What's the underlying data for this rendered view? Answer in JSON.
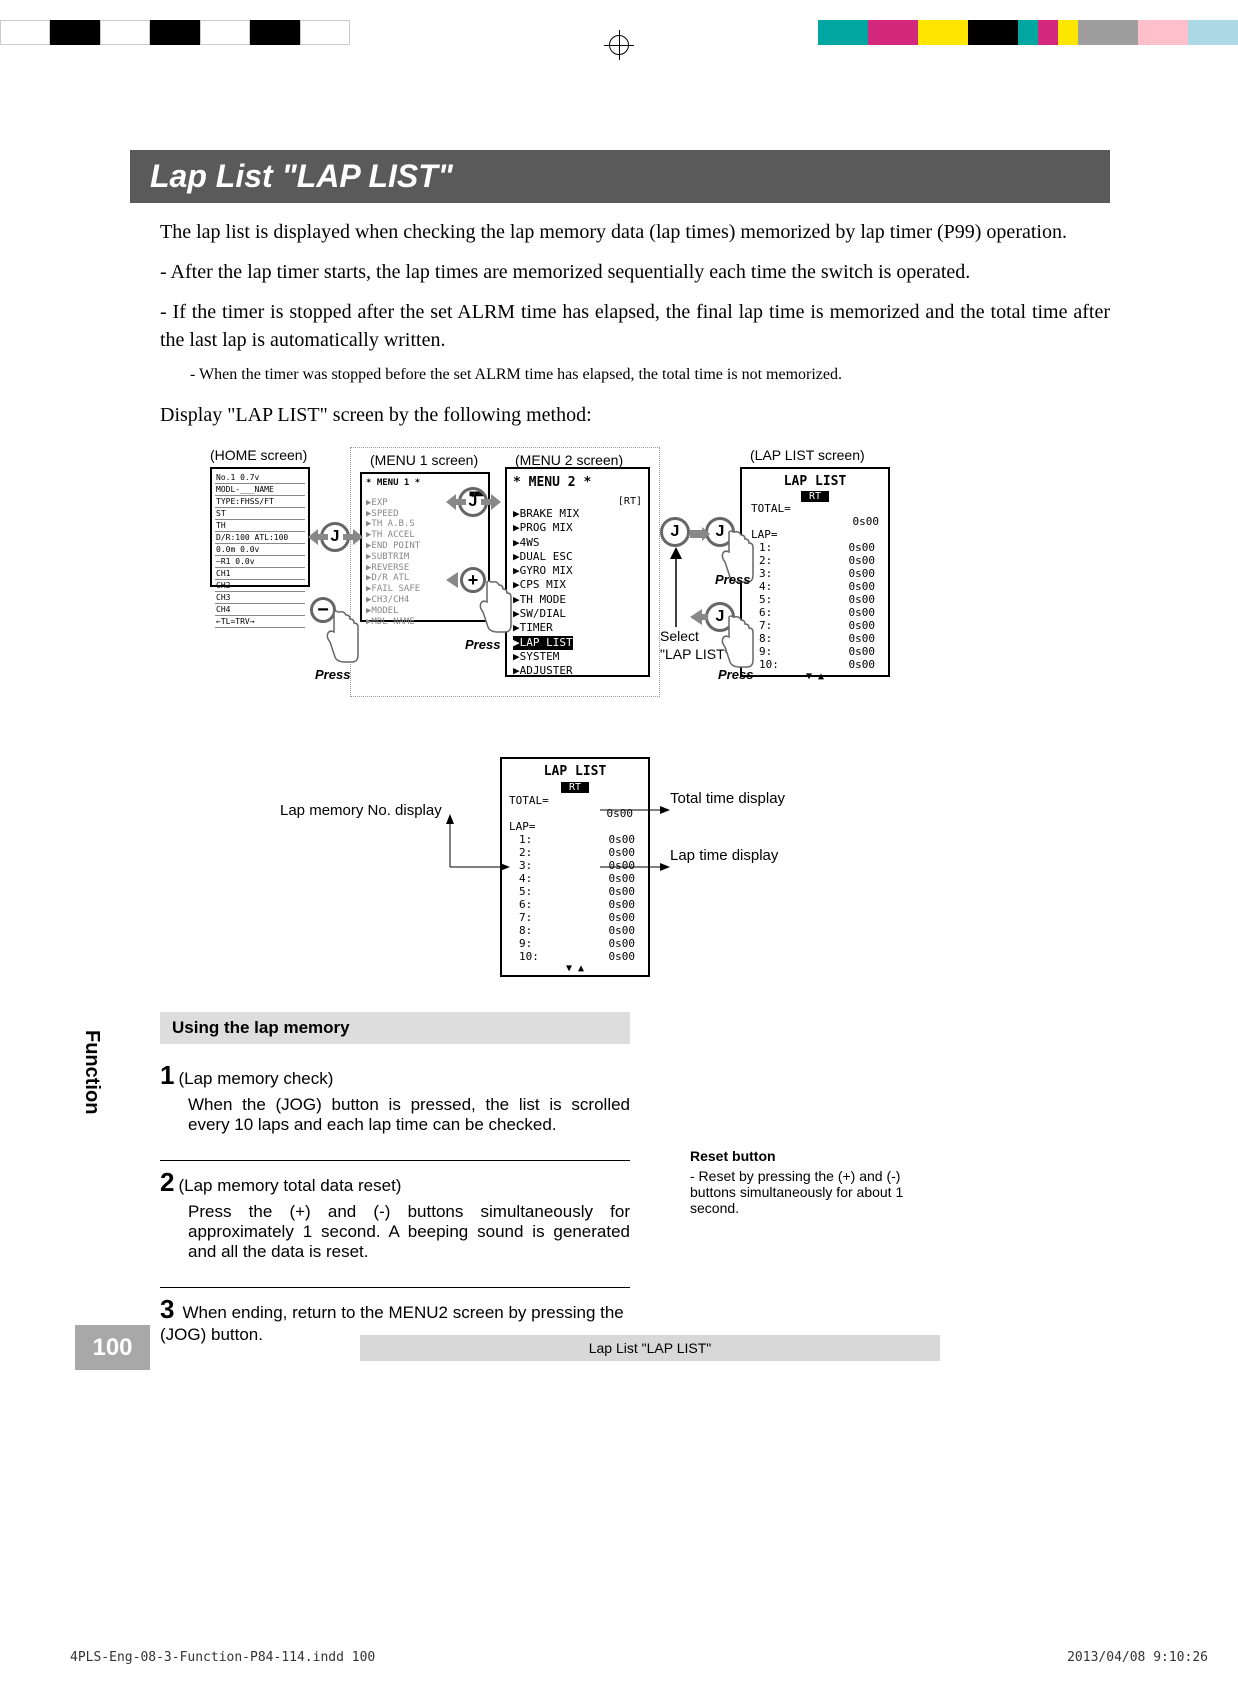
{
  "colorbars": {
    "left": [
      "#fff",
      "#000",
      "#fff",
      "#000",
      "#fff",
      "#000",
      "#fff"
    ],
    "right": [
      "#00a7a0",
      "#d4287d",
      "#ffe600",
      "#000",
      "#00a7a0",
      "#d4287d",
      "#ffe600",
      "#9e9e9e",
      "#9e9e9e",
      "#9e9e9e",
      "#ffc0cb",
      "#add8e6"
    ]
  },
  "title": "Lap List  \"LAP LIST\"",
  "intro1": "The lap list is displayed when checking the lap memory data (lap times) memorized by lap timer (P99) operation.",
  "intro2": "- After the lap timer starts, the lap times are memorized sequentially each time the switch is operated.",
  "intro3": "- If the timer is stopped after the set ALRM time has elapsed, the final lap time is memorized and the total time after the last lap is automatically written.",
  "intro_note": "- When the timer was stopped before the set ALRM time has elapsed, the total time is not memorized.",
  "subhead": "Display \"LAP LIST\" screen by the following method:",
  "screens": {
    "home": "(HOME screen)",
    "menu1": "(MENU 1 screen)",
    "menu2": "(MENU 2 screen)",
    "laplist": "(LAP LIST screen)"
  },
  "home_lines": [
    "No.1    0.7v",
    "MODL-___NAME",
    "TYPE:FHSS/FT",
    "ST",
    "TH",
    "D/R:100 ATL:100",
    "0.0m 0.0v",
    "—R1 0.0v",
    "CH1",
    "CH2",
    "CH3",
    "CH4",
    "←TL=TRV→"
  ],
  "menu1_hdr": "* MENU 1 *",
  "menu1_items": [
    "▶EXP",
    "▶SPEED",
    "▶TH A.B.S",
    "▶TH ACCEL",
    "▶END POINT",
    "▶SUBTRIM",
    "▶REVERSE",
    "▶D/R ATL",
    "▶FAIL SAFE",
    "▶CH3/CH4",
    "",
    "▶MODEL",
    "▶MDL NAME"
  ],
  "menu2_hdr": "* MENU 2 *",
  "menu2_rt": "[RT]",
  "menu2_items": [
    "▶BRAKE MIX",
    "▶PROG MIX",
    "▶4WS",
    "▶DUAL ESC",
    "▶GYRO MIX",
    "▶CPS MIX",
    "▶TH MODE",
    "",
    "▶SW/DIAL",
    "▶TIMER",
    "▶LAP LIST",
    "▶SYSTEM",
    "▶ADJUSTER"
  ],
  "menu2_selected_index": 10,
  "select_label": "Select\n\"LAP LIST\"",
  "press": "Press",
  "jog": "J",
  "plus": "+",
  "minus": "−",
  "laplist": {
    "header": "LAP LIST",
    "rt": "RT",
    "total_label": "TOTAL=",
    "total_value": "0s00",
    "lap_label": "LAP=",
    "laps": [
      {
        "n": "1:",
        "v": "0s00"
      },
      {
        "n": "2:",
        "v": "0s00"
      },
      {
        "n": "3:",
        "v": "0s00"
      },
      {
        "n": "4:",
        "v": "0s00"
      },
      {
        "n": "5:",
        "v": "0s00"
      },
      {
        "n": "6:",
        "v": "0s00"
      },
      {
        "n": "7:",
        "v": "0s00"
      },
      {
        "n": "8:",
        "v": "0s00"
      },
      {
        "n": "9:",
        "v": "0s00"
      },
      {
        "n": "10:",
        "v": "0s00"
      }
    ]
  },
  "callouts": {
    "total": "Total time display",
    "lap_no": "Lap memory No. display",
    "lap_time": "Lap time display"
  },
  "using_header": "Using the lap memory",
  "steps": [
    {
      "num": "1",
      "title": "(Lap memory check)",
      "body": "When the (JOG) button is pressed, the list is scrolled every 10 laps and each lap time can be checked."
    },
    {
      "num": "2",
      "title": "(Lap memory total data reset)",
      "body": "Press the (+) and (-) buttons simultaneously for approximately 1 second. A beeping sound is generated and all the data is reset."
    },
    {
      "num": "3",
      "title": "",
      "body": "When ending, return to the MENU2 screen by pressing the (JOG) button."
    }
  ],
  "reset": {
    "header": "Reset button",
    "body": "- Reset by pressing the (+) and (-) buttons simultaneously for about 1 second."
  },
  "function_tab": "Function",
  "page_number": "100",
  "footer_title": "Lap List  \"LAP LIST\"",
  "indd": "4PLS-Eng-08-3-Function-P84-114.indd   100",
  "indd_date": "2013/04/08   9:10:26"
}
